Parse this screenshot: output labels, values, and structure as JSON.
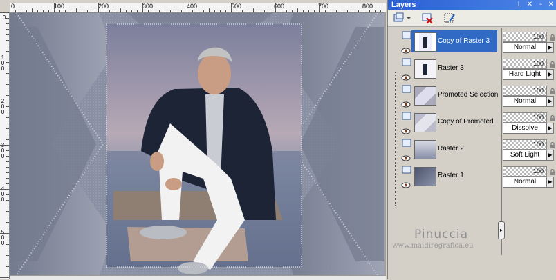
{
  "canvas": {
    "ruler_labels": [
      "0",
      "100",
      "200",
      "300",
      "400",
      "500",
      "600",
      "700",
      "800"
    ],
    "vruler_labels": [
      "0",
      "1 0 0",
      "2 0 0",
      "3 0 0",
      "4 0 0",
      "5 0 0"
    ]
  },
  "panel": {
    "title": "Layers",
    "title_buttons": [
      "pin-icon",
      "close-icon",
      "restore-icon",
      "close-x-icon"
    ],
    "toolbar": [
      "new-layer-icon",
      "delete-layer-icon",
      "edit-selection-icon"
    ]
  },
  "layers": [
    {
      "name": "Copy of Raster 3",
      "opacity": "100",
      "blend": "Normal",
      "selected": true
    },
    {
      "name": "Raster 3",
      "opacity": "100",
      "blend": "Hard Light",
      "selected": false
    },
    {
      "name": "Promoted Selection",
      "opacity": "100",
      "blend": "Normal",
      "selected": false
    },
    {
      "name": "Copy of Promoted",
      "opacity": "100",
      "blend": "Dissolve",
      "selected": false
    },
    {
      "name": "Raster 2",
      "opacity": "100",
      "blend": "Soft Light",
      "selected": false
    },
    {
      "name": "Raster 1",
      "opacity": "100",
      "blend": "Normal",
      "selected": false
    }
  ],
  "watermark": {
    "brand": "Pinuccia",
    "url": "www.maidiregrafica.eu"
  },
  "colors": {
    "title_bar": "#2a5fd2",
    "selection": "#316ac5",
    "jacket": "#1c2436",
    "pants": "#f2f2f2"
  }
}
